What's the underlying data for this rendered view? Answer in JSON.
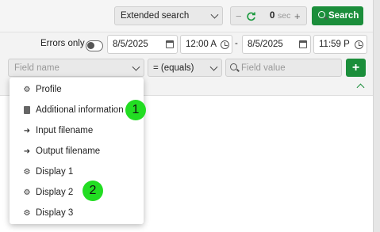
{
  "toolbar": {
    "search_mode": "Extended search",
    "refresh_value": "0",
    "refresh_unit": "sec",
    "minus_glyph": "−",
    "plus_glyph": "+",
    "search_label": "Search"
  },
  "filters": {
    "errors_only_label": "Errors only",
    "from_date": "8/5/2025",
    "from_time": "12:00 A",
    "range_separator": "-",
    "to_date": "8/5/2025",
    "to_time": "11:59 P",
    "field_name_placeholder": "Field name",
    "operator": "= (equals)",
    "field_value_placeholder": "Field value",
    "add_glyph": "+"
  },
  "field_menu": {
    "items": [
      {
        "label": "Profile",
        "icon": "gear-icon"
      },
      {
        "label": "Additional information",
        "icon": "document-icon"
      },
      {
        "label": "Input filename",
        "icon": "file-input-icon"
      },
      {
        "label": "Output filename",
        "icon": "file-output-icon"
      },
      {
        "label": "Display 1",
        "icon": "gear-icon"
      },
      {
        "label": "Display 2",
        "icon": "gear-icon"
      },
      {
        "label": "Display 3",
        "icon": "gear-icon"
      }
    ]
  },
  "annotations": {
    "marker_1": "1",
    "marker_2": "2"
  },
  "colors": {
    "accent_green": "#1b8e3b",
    "annotation_green": "#22dd22"
  }
}
